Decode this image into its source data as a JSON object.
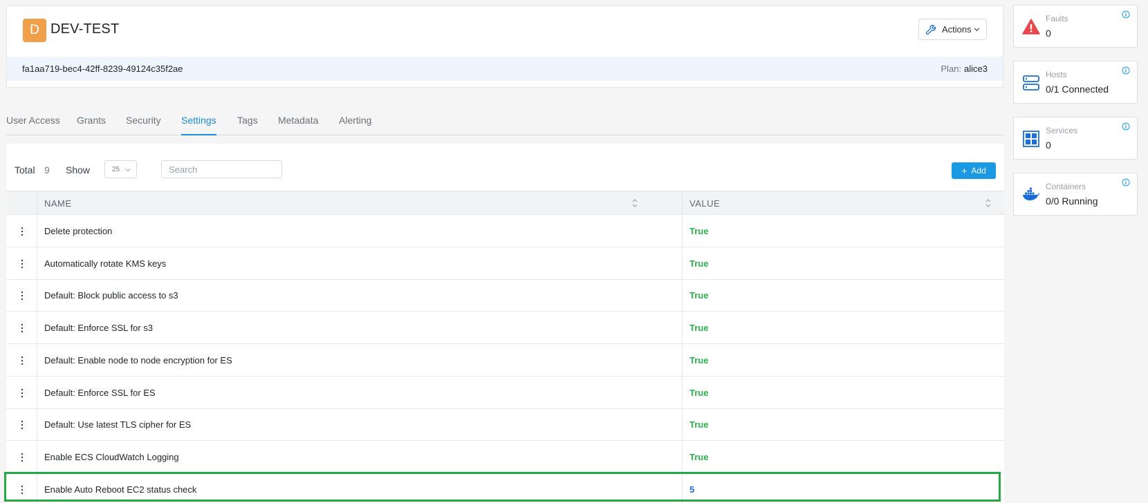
{
  "header": {
    "avatar_letter": "D",
    "tenant_name": "DEV-TEST",
    "actions_label": "Actions",
    "tenant_id": "fa1aa719-bec4-42ff-8239-49124c35f2ae",
    "plan_label": "Plan:",
    "plan_value": "alice3"
  },
  "tabs": [
    {
      "label": "User Access",
      "active": false
    },
    {
      "label": "Grants",
      "active": false
    },
    {
      "label": "Security",
      "active": false
    },
    {
      "label": "Settings",
      "active": true
    },
    {
      "label": "Tags",
      "active": false
    },
    {
      "label": "Metadata",
      "active": false
    },
    {
      "label": "Alerting",
      "active": false
    }
  ],
  "toolbar": {
    "total_label": "Total",
    "total_value": "9",
    "show_label": "Show",
    "show_value": "25",
    "search_placeholder": "Search",
    "add_label": "Add"
  },
  "table": {
    "columns": [
      "NAME",
      "VALUE"
    ],
    "rows": [
      {
        "name": "Delete protection",
        "value": "True"
      },
      {
        "name": "Automatically rotate KMS keys",
        "value": "True"
      },
      {
        "name": "Default: Block public access to s3",
        "value": "True"
      },
      {
        "name": "Default: Enforce SSL for s3",
        "value": "True"
      },
      {
        "name": "Default: Enable node to node encryption for ES",
        "value": "True"
      },
      {
        "name": "Default: Enforce SSL for ES",
        "value": "True"
      },
      {
        "name": "Default: Use latest TLS cipher for ES",
        "value": "True"
      },
      {
        "name": "Enable ECS CloudWatch Logging",
        "value": "True"
      },
      {
        "name": "Enable Auto Reboot EC2 status check",
        "value": "5"
      }
    ]
  },
  "stats": {
    "faults": {
      "label": "Faults",
      "value": "0",
      "icon": "warning-icon"
    },
    "hosts": {
      "label": "Hosts",
      "value": "0/1 Connected",
      "icon": "server-icon"
    },
    "services": {
      "label": "Services",
      "value": "0",
      "icon": "grid-icon"
    },
    "containers": {
      "label": "Containers",
      "value": "0/0 Running",
      "icon": "docker-icon"
    }
  },
  "colors": {
    "accent": "#1a8bd6",
    "true_value": "#2bb24c",
    "numeric_value": "#1a6fd6",
    "avatar": "#f0a04b",
    "highlight": "#27a844"
  }
}
